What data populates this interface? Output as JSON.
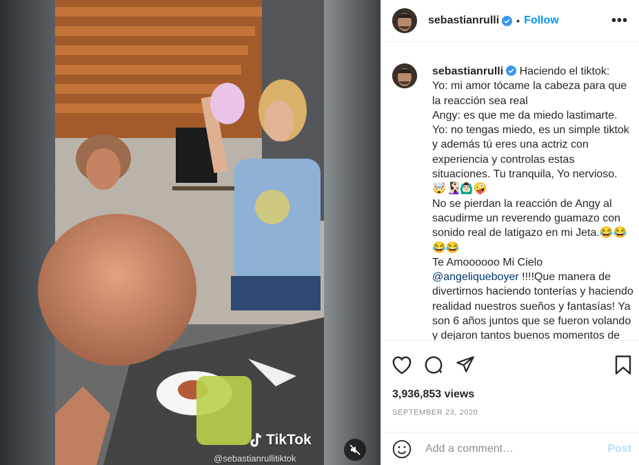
{
  "post": {
    "username": "sebastianrulli",
    "follow_label": "Follow",
    "more_label": "•••"
  },
  "media": {
    "watermark_text": "TikTok",
    "watermark_handle": "@sebastianrullitiktok"
  },
  "caption": {
    "username": "sebastianrulli",
    "line1": " Haciendo el tiktok:",
    "body_a": "Yo: mi amor tócame la cabeza para que la reacción sea real\nAngy: es que me da miedo lastimarte.\nYo: no tengas miedo, es un simple tiktok y además tú eres una actriz con experiencia y controlas estas situaciones. Tu tranquila, Yo nervioso.\n🤯🧏🏻‍♀️🙆🏻‍♂️🤪\nNo se pierdan la reacción de Angy al sacudirme un reverendo guamazo con sonido real de latigazo en mi Jeta.😂😂\n😂😂\nTe Amoooooo Mi Cielo\n",
    "mention": "@angeliqueboyer",
    "body_b": " !!!!Que manera de divertirnos haciendo tonterías y haciendo realidad nuestros sueños y fantasías! Ya son 6 años juntos que se fueron volando y dejaron tantos buenos momentos de amor"
  },
  "stats": {
    "views": "3,936,853 views",
    "date": "SEPTEMBER 23, 2020"
  },
  "comment": {
    "placeholder": "Add a comment…",
    "post_label": "Post"
  },
  "colors": {
    "accent": "#0095f6",
    "verified": "#3897f0",
    "post_disabled": "#b2dffc"
  }
}
